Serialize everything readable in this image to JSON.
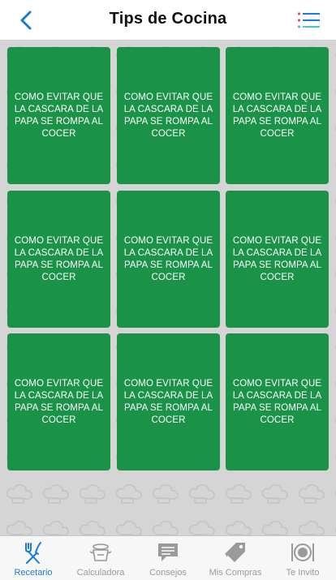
{
  "header": {
    "title": "Tips de Cocina",
    "back_icon": "chevron-left-icon",
    "menu_icon": "list-icon",
    "accent_color": "#1a7ad6"
  },
  "tips": [
    {
      "title": "COMO EVITAR QUE LA CASCARA DE LA PAPA SE ROMPA AL COCER"
    },
    {
      "title": "COMO EVITAR QUE LA CASCARA DE LA PAPA SE ROMPA AL COCER"
    },
    {
      "title": "COMO EVITAR QUE LA CASCARA DE LA PAPA SE ROMPA AL COCER"
    },
    {
      "title": "COMO EVITAR QUE LA CASCARA DE LA PAPA SE ROMPA AL COCER"
    },
    {
      "title": "COMO EVITAR QUE LA CASCARA DE LA PAPA SE ROMPA AL COCER"
    },
    {
      "title": "COMO EVITAR QUE LA CASCARA DE LA PAPA SE ROMPA AL COCER"
    },
    {
      "title": "COMO EVITAR QUE LA CASCARA DE LA PAPA SE ROMPA AL COCER"
    },
    {
      "title": "COMO EVITAR QUE LA CASCARA DE LA PAPA SE ROMPA AL COCER"
    },
    {
      "title": "COMO EVITAR QUE LA CASCARA DE LA PAPA SE ROMPA AL COCER"
    }
  ],
  "tile_color": "#1a9248",
  "tabbar": {
    "items": [
      {
        "label": "Recetario",
        "icon": "fork-knife-icon",
        "active": true
      },
      {
        "label": "Calculadora",
        "icon": "scale-icon",
        "active": false
      },
      {
        "label": "Consejos",
        "icon": "chat-bubble-icon",
        "active": false
      },
      {
        "label": "Mis Compras",
        "icon": "tag-icon",
        "active": false
      },
      {
        "label": "Te Invito",
        "icon": "plate-icon",
        "active": false
      }
    ]
  }
}
